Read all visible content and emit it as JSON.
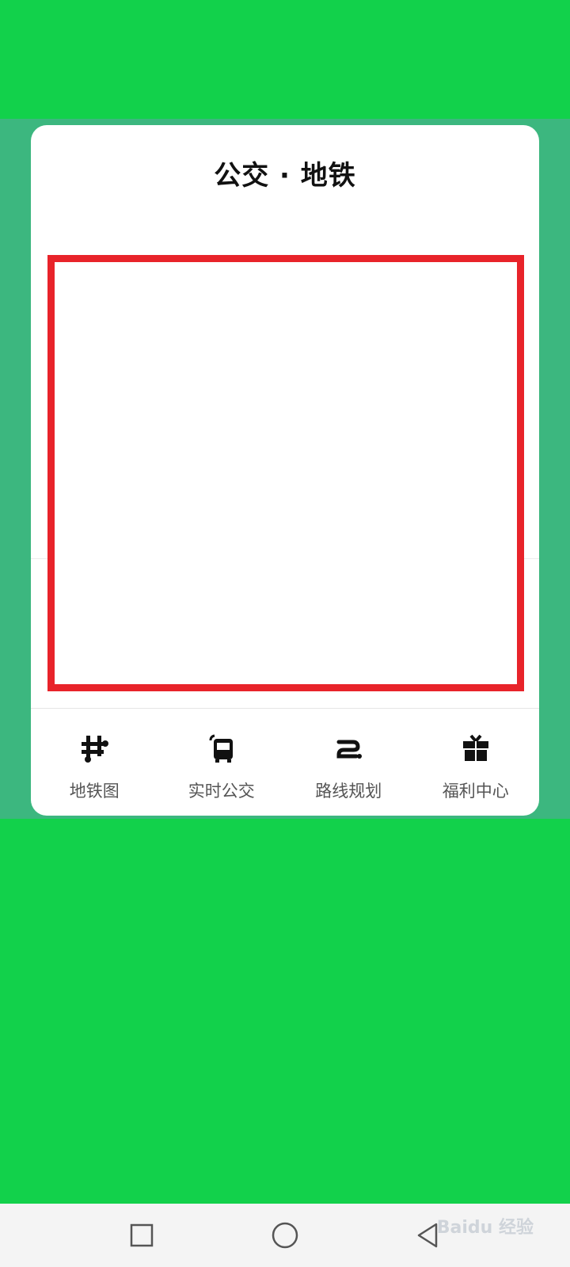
{
  "card": {
    "title": "公交 · 地铁"
  },
  "tabs": [
    {
      "label": "地铁图",
      "icon": "subway-map-icon"
    },
    {
      "label": "实时公交",
      "icon": "realtime-bus-icon"
    },
    {
      "label": "路线规划",
      "icon": "route-planning-icon"
    },
    {
      "label": "福利中心",
      "icon": "gift-icon"
    }
  ],
  "navbar": {
    "buttons": [
      "recent-apps-icon",
      "home-icon",
      "back-icon"
    ]
  },
  "watermark": {
    "text": "Baidu 经验"
  },
  "colors": {
    "background": "#12d14b",
    "map_band": "#3cb77f",
    "highlight_frame": "#e8232a"
  }
}
